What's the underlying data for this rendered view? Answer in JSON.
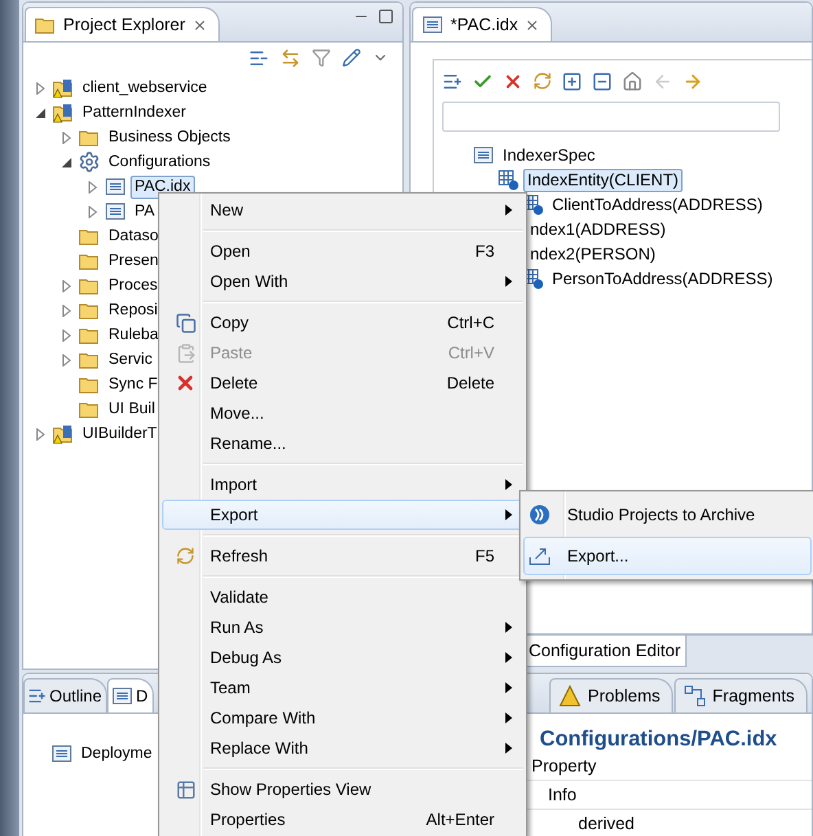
{
  "left_panel": {
    "tab": "Project Explorer",
    "tree": [
      {
        "label": "client_webservice",
        "kind": "project",
        "expanded": false,
        "selected": false
      },
      {
        "label": "PatternIndexer",
        "kind": "project",
        "expanded": true,
        "selected": false,
        "children": [
          {
            "label": "Business Objects",
            "kind": "folder",
            "expanded": false,
            "selected": false
          },
          {
            "label": "Configurations",
            "kind": "config",
            "expanded": true,
            "selected": false,
            "children": [
              {
                "label": "PAC.idx",
                "kind": "file",
                "expanded": false,
                "selected": true
              },
              {
                "label": "PA",
                "kind": "file",
                "expanded": false,
                "selected": false
              }
            ]
          },
          {
            "label": "Dataso",
            "kind": "folder",
            "selected": false
          },
          {
            "label": "Presen",
            "kind": "folder",
            "selected": false
          },
          {
            "label": "Proces",
            "kind": "folder",
            "expanded": false,
            "selected": false
          },
          {
            "label": "Reposi",
            "kind": "folder",
            "expanded": false,
            "selected": false
          },
          {
            "label": "Ruleba",
            "kind": "folder",
            "expanded": false,
            "selected": false
          },
          {
            "label": "Servic",
            "kind": "folder",
            "expanded": false,
            "selected": false
          },
          {
            "label": "Sync F",
            "kind": "folder",
            "selected": false
          },
          {
            "label": "UI Buil",
            "kind": "folder",
            "selected": false
          }
        ]
      },
      {
        "label": "UIBuilderT",
        "kind": "project",
        "expanded": false,
        "selected": false
      }
    ]
  },
  "editor": {
    "tab": "*PAC.idx",
    "tree": [
      {
        "label": "IndexerSpec",
        "kind": "spec",
        "selected": false,
        "children": [
          {
            "label": "IndexEntity(CLIENT)",
            "kind": "entity",
            "selected": true,
            "children": [
              {
                "label": "ClientToAddress(ADDRESS)",
                "kind": "entity",
                "selected": false
              }
            ]
          },
          {
            "label": "ndex1(ADDRESS)",
            "kind": "covered",
            "selected": false
          },
          {
            "label": "ndex2(PERSON)",
            "kind": "covered",
            "selected": false,
            "children": [
              {
                "label": "PersonToAddress(ADDRESS)",
                "kind": "entity",
                "selected": false
              }
            ]
          }
        ]
      }
    ],
    "bottom_tab": "Configuration Editor"
  },
  "outline_panel": {
    "tabs": [
      {
        "label": "Outline",
        "selected": false
      },
      {
        "label": "D",
        "selected": true
      }
    ],
    "items": [
      "Deployme"
    ]
  },
  "properties_panel": {
    "tabs": [
      {
        "label": "Problems",
        "selected": false
      },
      {
        "label": "Fragments",
        "selected": false
      }
    ],
    "title": "Configurations/PAC.idx",
    "column": "Property",
    "rows": [
      {
        "label": "Info",
        "children": [
          {
            "label": "derived"
          }
        ]
      }
    ]
  },
  "context_menu": [
    {
      "kind": "item",
      "label": "New",
      "submenu": true,
      "disabled": false,
      "selected": false
    },
    {
      "kind": "separator"
    },
    {
      "kind": "item",
      "label": "Open",
      "shortcut": "F3",
      "disabled": false,
      "selected": false
    },
    {
      "kind": "item",
      "label": "Open With",
      "submenu": true,
      "disabled": false,
      "selected": false
    },
    {
      "kind": "separator"
    },
    {
      "kind": "item",
      "label": "Copy",
      "shortcut": "Ctrl+C",
      "disabled": false,
      "selected": false
    },
    {
      "kind": "item",
      "label": "Paste",
      "shortcut": "Ctrl+V",
      "disabled": true,
      "selected": false
    },
    {
      "kind": "item",
      "label": "Delete",
      "shortcut": "Delete",
      "disabled": false,
      "selected": false
    },
    {
      "kind": "item",
      "label": "Move...",
      "disabled": false,
      "selected": false
    },
    {
      "kind": "item",
      "label": "Rename...",
      "disabled": false,
      "selected": false
    },
    {
      "kind": "separator"
    },
    {
      "kind": "item",
      "label": "Import",
      "submenu": true,
      "disabled": false,
      "selected": false
    },
    {
      "kind": "item",
      "label": "Export",
      "submenu": true,
      "disabled": false,
      "selected": true
    },
    {
      "kind": "separator"
    },
    {
      "kind": "item",
      "label": "Refresh",
      "shortcut": "F5",
      "disabled": false,
      "selected": false
    },
    {
      "kind": "separator"
    },
    {
      "kind": "item",
      "label": "Validate",
      "disabled": false,
      "selected": false
    },
    {
      "kind": "item",
      "label": "Run As",
      "submenu": true,
      "disabled": false,
      "selected": false
    },
    {
      "kind": "item",
      "label": "Debug As",
      "submenu": true,
      "disabled": false,
      "selected": false
    },
    {
      "kind": "item",
      "label": "Team",
      "submenu": true,
      "disabled": false,
      "selected": false
    },
    {
      "kind": "item",
      "label": "Compare With",
      "submenu": true,
      "disabled": false,
      "selected": false
    },
    {
      "kind": "item",
      "label": "Replace With",
      "submenu": true,
      "disabled": false,
      "selected": false
    },
    {
      "kind": "separator"
    },
    {
      "kind": "item",
      "label": "Show Properties View",
      "disabled": false,
      "selected": false
    },
    {
      "kind": "item",
      "label": "Properties",
      "shortcut": "Alt+Enter",
      "disabled": false,
      "selected": false
    }
  ],
  "submenu": [
    {
      "label": "Studio Projects to Archive",
      "selected": false
    },
    {
      "label": "Export...",
      "selected": true
    }
  ]
}
